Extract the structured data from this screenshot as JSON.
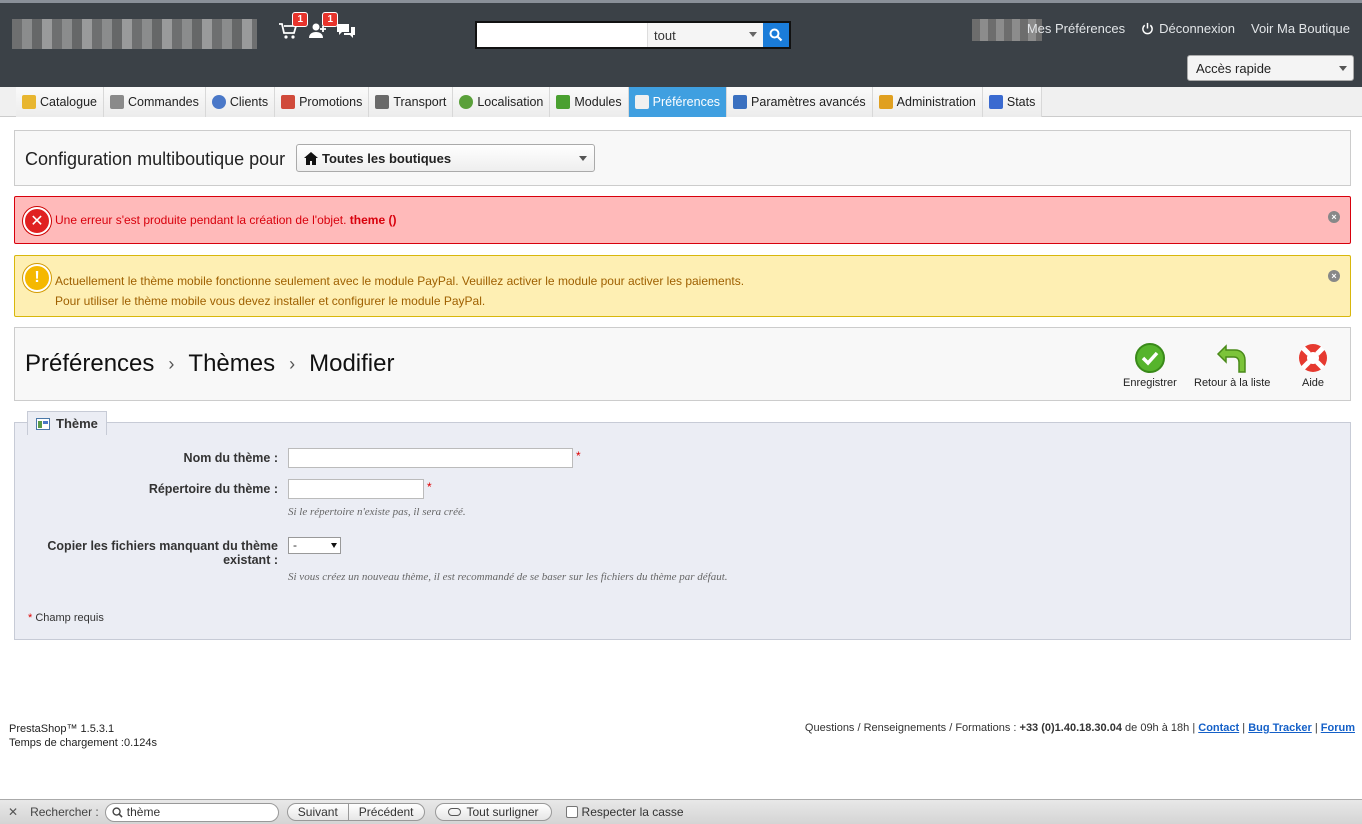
{
  "header": {
    "cart_badge": "1",
    "customers_badge": "1",
    "search": {
      "value": "",
      "scope": "tout"
    },
    "links": {
      "preferences": "Mes Préférences",
      "logout": "Déconnexion",
      "view_shop": "Voir Ma Boutique"
    },
    "quick_access": "Accès rapide"
  },
  "nav": {
    "tabs": [
      {
        "label": "Catalogue",
        "icon": "folder-icon",
        "color": "#e8b630"
      },
      {
        "label": "Commandes",
        "icon": "cart-icon",
        "color": "#8a8a8a"
      },
      {
        "label": "Clients",
        "icon": "user-icon",
        "color": "#4a78c8"
      },
      {
        "label": "Promotions",
        "icon": "promo-icon",
        "color": "#d04a3a"
      },
      {
        "label": "Transport",
        "icon": "truck-icon",
        "color": "#6a6a6a"
      },
      {
        "label": "Localisation",
        "icon": "globe-icon",
        "color": "#5aa03a"
      },
      {
        "label": "Modules",
        "icon": "puzzle-icon",
        "color": "#4aa030"
      },
      {
        "label": "Préférences",
        "icon": "preferences-icon",
        "color": "#f0f0f0",
        "active": true
      },
      {
        "label": "Paramètres avancés",
        "icon": "wrench-icon",
        "color": "#3a70c0"
      },
      {
        "label": "Administration",
        "icon": "key-icon",
        "color": "#e0a020"
      },
      {
        "label": "Stats",
        "icon": "bar-chart-icon",
        "color": "#3a6ad0"
      }
    ]
  },
  "multishop": {
    "label": "Configuration multiboutique pour",
    "selected": "Toutes les boutiques"
  },
  "alerts": {
    "error": {
      "text": "Une erreur s'est produite pendant la création de l'objet.",
      "strong": "theme ()"
    },
    "warning": {
      "line1": "Actuellement le thème mobile fonctionne seulement avec le module PayPal. Veuillez activer le module pour activer les paiements.",
      "line2": "Pour utiliser le thème mobile vous devez installer et configurer le module PayPal."
    }
  },
  "breadcrumb": {
    "level1": "Préférences",
    "level2": "Thèmes",
    "level3": "Modifier"
  },
  "toolbar": {
    "save": "Enregistrer",
    "back": "Retour à la liste",
    "help": "Aide"
  },
  "form": {
    "legend": "Thème",
    "name_label": "Nom du thème :",
    "name_value": "",
    "dir_label": "Répertoire du thème :",
    "dir_value": "",
    "dir_hint": "Si le répertoire n'existe pas, il sera créé.",
    "copy_label_1": "Copier les fichiers manquant du thème",
    "copy_label_2": "existant :",
    "copy_value": "-",
    "copy_hint": "Si vous créez un nouveau thème, il est recommandé de se baser sur les fichiers du thème par défaut.",
    "required_star": "*",
    "required_note": "Champ requis"
  },
  "footer": {
    "version": "PrestaShop™ 1.5.3.1",
    "load_time": "Temps de chargement :0.124s",
    "support_text": "Questions / Renseignements / Formations :",
    "phone": "+33 (0)1.40.18.30.04",
    "hours": "de 09h à 18h |",
    "contact": "Contact",
    "bug_tracker": "Bug Tracker",
    "forum": "Forum",
    "pipe": "|"
  },
  "findbar": {
    "close": "✕",
    "label": "Rechercher :",
    "value": "thème",
    "next": "Suivant",
    "prev": "Précédent",
    "highlight": "Tout surligner",
    "match_case": "Respecter la casse"
  }
}
